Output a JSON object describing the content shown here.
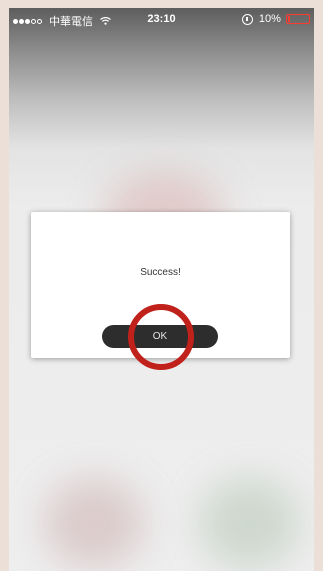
{
  "status_bar": {
    "carrier": "中華電信",
    "time": "23:10",
    "battery_percent_text": "10%",
    "battery_level": 0.1,
    "signal_bars_filled": 3,
    "signal_bars_total": 5,
    "battery_color": "#ff3b30"
  },
  "dialog": {
    "message": "Success!",
    "ok_label": "OK"
  },
  "annotation": {
    "highlight_color": "#c0221b",
    "target": "ok-button"
  }
}
